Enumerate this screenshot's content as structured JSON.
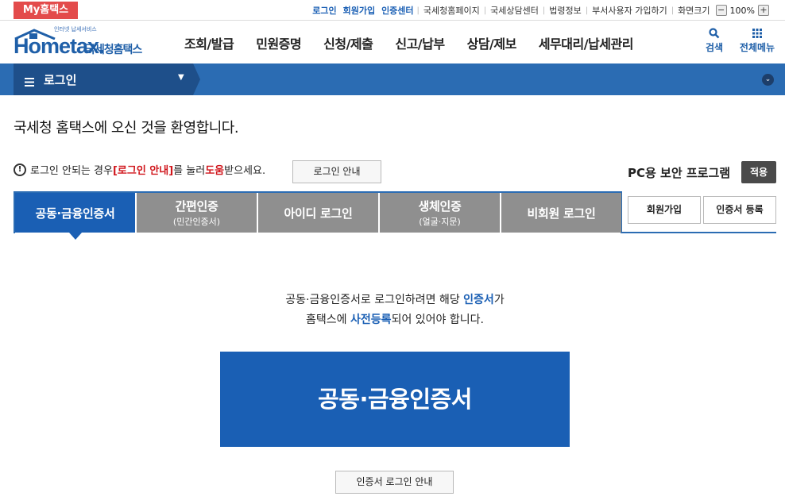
{
  "utilbar": {
    "my_label": "My홈택스",
    "links_blue": [
      "로그인",
      "회원가입",
      "인증센터"
    ],
    "links": [
      "국세청홈페이지",
      "국세상담센터",
      "법령정보",
      "부서사용자 가입하기",
      "화면크기"
    ],
    "zoom": "100%",
    "zoom_minus": "−",
    "zoom_plus": "+"
  },
  "header": {
    "logo_sub": "인터넷 납세서비스",
    "logo_word": "Hometax.",
    "logo_kor": "국세청홈택스",
    "gnb": [
      "조회/발급",
      "민원증명",
      "신청/제출",
      "신고/납부",
      "상담/제보",
      "세무대리/납세관리"
    ],
    "search_label": "검색",
    "menu_label": "전체메뉴"
  },
  "locbar": {
    "title": "로그인",
    "caret": "▼",
    "circle": "⌄"
  },
  "content": {
    "welcome": "국세청 홈택스에 오신 것을 환영합니다.",
    "notice_pre": "로그인 안되는 경우 ",
    "notice_link": "[로그인 안내]",
    "notice_mid": "를 눌러 ",
    "notice_help": "도움",
    "notice_post": "받으세요.",
    "notice_button": "로그인 안내",
    "pc_security": "PC용 보안 프로그램",
    "apply_button": "적용"
  },
  "tabs": [
    {
      "main": "공동·금융인증서",
      "sub": ""
    },
    {
      "main": "간편인증",
      "sub": "(민간인증서)"
    },
    {
      "main": "아이디 로그인",
      "sub": ""
    },
    {
      "main": "생체인증",
      "sub": "(얼굴·지문)"
    },
    {
      "main": "비회원 로그인",
      "sub": ""
    }
  ],
  "side_buttons": {
    "join": "회원가입",
    "cert_register": "인증서 등록"
  },
  "panel": {
    "line1_pre": "공동·금융인증서로 로그인하려면 해당 ",
    "line1_em": "인증서",
    "line1_post": "가",
    "line2_pre": "홈택스에 ",
    "line2_em": "사전등록",
    "line2_post": "되어 있어야 합니다.",
    "cert_button": "공동·금융인증서",
    "guide_button": "인증서 로그인 안내"
  }
}
